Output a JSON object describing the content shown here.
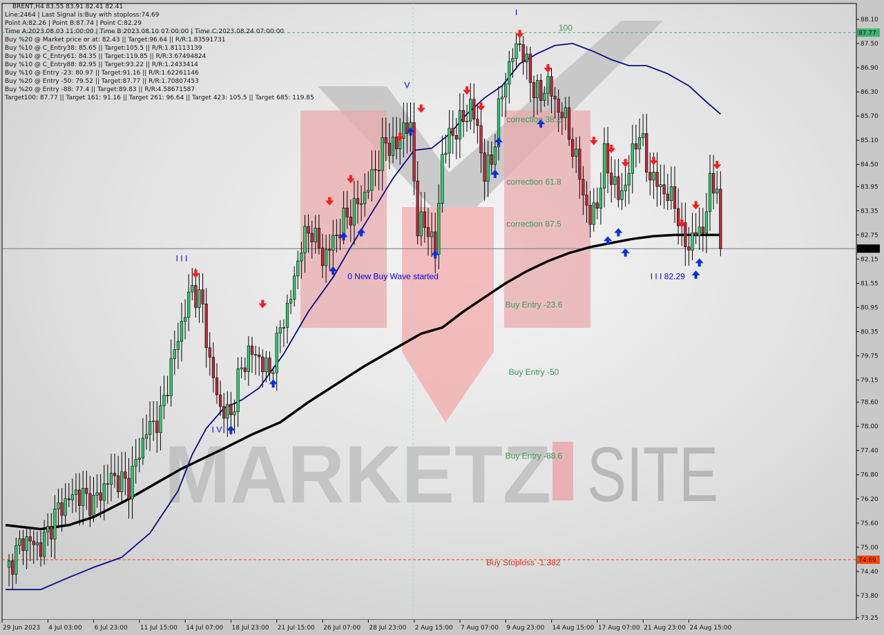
{
  "header": {
    "symbol_line": "BRENT,H4  83.55 83.91 82.41 82.41",
    "info_lines": [
      "Line:2464 | Last Signal is:Buy with stoploss:74.69",
      "Point A:82.26 | Point B:87.74 | Point C:82.29",
      "Time A:2023.08.03 11:00:00 | Time B:2023.08.10 07:00:00 | Time C:2023.08.24 07:00:00",
      "Buy %20 @ Market price or at: 82.43 || Target:96.64 || R/R:1.83591731",
      "Buy %10 @ C_Entry38: 85.65 || Target:105.5 || R/R:1.81113139",
      "Buy %10 @ C_Entry61: 84.35 || Target:119.85 || R/R:3.67494824",
      "Buy %10 @ C_Entry88: 82.95 || Target:93.22 || R/R:1.2433414",
      "Buy %10 @ Entry -23: 80.97 || Target:91.16 || R/R:1.62261146",
      "Buy %20 @ Entry -50: 79.52 || Target:87.77 || R/R:1.70807453",
      "Buy %20 @ Entry -88: 77.4 || Target:89.83 || R/R:4.58671587",
      "Target100: 87.77 || Target 161: 91.16 || Target 261: 96.64 || Target 423: 105.5 || Target 685: 119.85"
    ]
  },
  "watermark": {
    "left": "MARKETZ",
    "right": "SITE"
  },
  "colors": {
    "bull": "#2ecc71",
    "bear": "#c0283c",
    "ma_fast": "#0a0a8a",
    "ma_slow": "#000000",
    "target_line": "#3cb371",
    "stop_line": "#ff4500",
    "price_line": "#6a7a8a",
    "annotation_green": "#3c9a5a",
    "annotation_blue": "#0000dd",
    "annotation_red": "#e8321e",
    "signal_up": "#0a2ee0",
    "signal_down": "#ff1a1a"
  },
  "chart_data": {
    "type": "candlestick",
    "symbol": "BRENT",
    "timeframe": "H4",
    "ohlc_last": {
      "open": 83.55,
      "high": 83.91,
      "low": 82.41,
      "close": 82.41
    },
    "ylim": [
      73.25,
      88.4
    ],
    "y_ticks": [
      "88.10",
      "87.50",
      "86.90",
      "86.30",
      "85.70",
      "85.10",
      "84.50",
      "83.95",
      "83.35",
      "82.75",
      "82.15",
      "81.55",
      "80.95",
      "80.35",
      "79.75",
      "79.15",
      "78.60",
      "78.00",
      "77.40",
      "76.80",
      "76.20",
      "75.60",
      "75.00",
      "74.40",
      "73.80",
      "73.25"
    ],
    "y_tick_values": [
      88.1,
      87.5,
      86.9,
      86.3,
      85.7,
      85.1,
      84.5,
      83.95,
      83.35,
      82.75,
      82.15,
      81.55,
      80.95,
      80.35,
      79.75,
      79.15,
      78.6,
      78.0,
      77.4,
      76.8,
      76.2,
      75.6,
      75.0,
      74.4,
      73.8,
      73.25
    ],
    "x_ticks": [
      "29 Jun 2023",
      "4 Jul 03:00",
      "6 Jul 23:00",
      "11 Jul 15:00",
      "14 Jul 07:00",
      "18 Jul 23:00",
      "21 Jul 15:00",
      "26 Jul 07:00",
      "28 Jul 23:00",
      "2 Aug 15:00",
      "7 Aug 07:00",
      "9 Aug 23:00",
      "14 Aug 15:00",
      "17 Aug 07:00",
      "21 Aug 23:00",
      "24 Aug 15:00"
    ],
    "x_tick_bar_index": [
      0,
      13,
      26,
      39,
      52,
      65,
      78,
      91,
      104,
      117,
      130,
      143,
      156,
      169,
      182,
      195
    ],
    "bar_count": 244,
    "levels": [
      {
        "name": "target-100",
        "value": 87.77,
        "label": "87.77",
        "style": "dashed",
        "color": "#3cb371"
      },
      {
        "name": "current-price",
        "value": 82.41,
        "label": "82.41",
        "style": "solid",
        "color": "#6a7a8a"
      },
      {
        "name": "buy-stoploss",
        "value": 74.69,
        "label": "74.69",
        "style": "dashed",
        "color": "#ff4500"
      }
    ],
    "annotations": [
      {
        "text": "100",
        "bar": 159,
        "price": 87.82,
        "color": "#3c9a5a"
      },
      {
        "text": "correction 38.2",
        "bar": 150,
        "price": 85.55,
        "color": "#3c9a5a"
      },
      {
        "text": "correction 61.8",
        "bar": 150,
        "price": 84.0,
        "color": "#3c9a5a"
      },
      {
        "text": "correction 87.5",
        "bar": 150,
        "price": 82.95,
        "color": "#3c9a5a"
      },
      {
        "text": "Buy Entry -23.6",
        "bar": 150,
        "price": 80.95,
        "color": "#3c9a5a"
      },
      {
        "text": "Buy Entry -50",
        "bar": 150,
        "price": 79.28,
        "color": "#3c9a5a"
      },
      {
        "text": "Buy Entry -88.6",
        "bar": 150,
        "price": 77.2,
        "color": "#3c9a5a"
      },
      {
        "text": "Buy Stoploss -1.382",
        "bar": 147,
        "price": 74.55,
        "color": "#e8321e"
      },
      {
        "text": "0 New Buy Wave started",
        "bar": 110,
        "price": 81.65,
        "color": "#0000dd"
      },
      {
        "text": "I I I 82.29",
        "bar": 188,
        "price": 81.65,
        "color": "#0000dd"
      }
    ],
    "wave_labels": [
      {
        "text": "I",
        "bar": 145,
        "price": 88.2
      },
      {
        "text": "I I I",
        "bar": 50,
        "price": 82.1
      },
      {
        "text": "I V",
        "bar": 60,
        "price": 77.85
      },
      {
        "text": "V",
        "bar": 114,
        "price": 86.4
      }
    ],
    "signals_down": [
      {
        "bar": 54,
        "price": 81.75
      },
      {
        "bar": 73,
        "price": 81.0
      },
      {
        "bar": 92,
        "price": 83.55
      },
      {
        "bar": 98,
        "price": 84.1
      },
      {
        "bar": 112,
        "price": 85.15
      },
      {
        "bar": 118,
        "price": 85.85
      },
      {
        "bar": 131,
        "price": 86.3
      },
      {
        "bar": 135,
        "price": 85.9
      },
      {
        "bar": 146,
        "price": 87.7
      },
      {
        "bar": 154,
        "price": 86.85
      },
      {
        "bar": 167,
        "price": 85.05
      },
      {
        "bar": 172,
        "price": 84.85
      },
      {
        "bar": 176,
        "price": 84.5
      },
      {
        "bar": 184,
        "price": 84.55
      },
      {
        "bar": 192,
        "price": 83.0
      },
      {
        "bar": 196,
        "price": 83.45
      },
      {
        "bar": 202,
        "price": 84.45
      }
    ],
    "signals_up": [
      {
        "bar": 64,
        "price": 77.95
      },
      {
        "bar": 76,
        "price": 79.1
      },
      {
        "bar": 93,
        "price": 81.9
      },
      {
        "bar": 96,
        "price": 82.75
      },
      {
        "bar": 101,
        "price": 82.85
      },
      {
        "bar": 115,
        "price": 85.35
      },
      {
        "bar": 122,
        "price": 82.3
      },
      {
        "bar": 139,
        "price": 84.3
      },
      {
        "bar": 140,
        "price": 85.1
      },
      {
        "bar": 152,
        "price": 85.55
      },
      {
        "bar": 171,
        "price": 82.65
      },
      {
        "bar": 174,
        "price": 82.85
      },
      {
        "bar": 176,
        "price": 82.35
      },
      {
        "bar": 196,
        "price": 81.8
      },
      {
        "bar": 197,
        "price": 82.1
      }
    ],
    "ma_fast": [
      [
        0,
        73.95
      ],
      [
        10,
        73.95
      ],
      [
        18,
        74.25
      ],
      [
        25,
        74.5
      ],
      [
        33,
        74.75
      ],
      [
        41,
        75.35
      ],
      [
        49,
        76.4
      ],
      [
        53,
        77.3
      ],
      [
        57,
        77.95
      ],
      [
        62,
        78.45
      ],
      [
        67,
        78.65
      ],
      [
        72,
        78.95
      ],
      [
        79,
        79.8
      ],
      [
        86,
        80.85
      ],
      [
        93,
        81.7
      ],
      [
        98,
        82.45
      ],
      [
        104,
        83.3
      ],
      [
        110,
        84.15
      ],
      [
        116,
        84.85
      ],
      [
        121,
        84.9
      ],
      [
        126,
        85.25
      ],
      [
        131,
        85.75
      ],
      [
        136,
        86.15
      ],
      [
        141,
        86.45
      ],
      [
        146,
        87.0
      ],
      [
        151,
        87.25
      ],
      [
        156,
        87.45
      ],
      [
        161,
        87.5
      ],
      [
        167,
        87.3
      ],
      [
        172,
        87.1
      ],
      [
        177,
        86.95
      ],
      [
        182,
        86.95
      ],
      [
        188,
        86.75
      ],
      [
        194,
        86.45
      ],
      [
        199,
        86.05
      ],
      [
        203,
        85.75
      ]
    ],
    "ma_slow": [
      [
        0,
        75.55
      ],
      [
        10,
        75.45
      ],
      [
        18,
        75.55
      ],
      [
        25,
        75.75
      ],
      [
        34,
        76.15
      ],
      [
        42,
        76.55
      ],
      [
        50,
        76.95
      ],
      [
        56,
        77.2
      ],
      [
        62,
        77.45
      ],
      [
        70,
        77.8
      ],
      [
        78,
        78.1
      ],
      [
        86,
        78.6
      ],
      [
        94,
        79.05
      ],
      [
        102,
        79.5
      ],
      [
        110,
        79.9
      ],
      [
        118,
        80.3
      ],
      [
        124,
        80.45
      ],
      [
        130,
        80.85
      ],
      [
        136,
        81.2
      ],
      [
        142,
        81.55
      ],
      [
        148,
        81.85
      ],
      [
        154,
        82.1
      ],
      [
        160,
        82.3
      ],
      [
        166,
        82.45
      ],
      [
        172,
        82.55
      ],
      [
        178,
        82.65
      ],
      [
        184,
        82.72
      ],
      [
        190,
        82.75
      ],
      [
        196,
        82.75
      ],
      [
        203,
        82.75
      ]
    ],
    "candles_key": [
      [
        0,
        74.35
      ],
      [
        5,
        75.2
      ],
      [
        10,
        75.0
      ],
      [
        15,
        75.95
      ],
      [
        20,
        76.35
      ],
      [
        25,
        76.1
      ],
      [
        30,
        76.75
      ],
      [
        35,
        76.55
      ],
      [
        40,
        77.9
      ],
      [
        44,
        78.25
      ],
      [
        47,
        79.5
      ],
      [
        50,
        80.55
      ],
      [
        53,
        81.45
      ],
      [
        56,
        80.95
      ],
      [
        58,
        79.55
      ],
      [
        61,
        78.45
      ],
      [
        64,
        78.25
      ],
      [
        66,
        79.15
      ],
      [
        69,
        79.85
      ],
      [
        72,
        79.7
      ],
      [
        75,
        79.3
      ],
      [
        78,
        80.4
      ],
      [
        81,
        81.2
      ],
      [
        84,
        82.55
      ],
      [
        87,
        82.9
      ],
      [
        90,
        82.15
      ],
      [
        93,
        82.6
      ],
      [
        96,
        83.1
      ],
      [
        99,
        83.4
      ],
      [
        102,
        83.75
      ],
      [
        105,
        84.4
      ],
      [
        108,
        85.05
      ],
      [
        111,
        84.9
      ],
      [
        113,
        85.5
      ],
      [
        115,
        85.3
      ],
      [
        117,
        83.0
      ],
      [
        120,
        82.95
      ],
      [
        122,
        82.3
      ],
      [
        124,
        84.75
      ],
      [
        127,
        85.3
      ],
      [
        130,
        85.6
      ],
      [
        132,
        85.95
      ],
      [
        134,
        85.4
      ],
      [
        136,
        84.25
      ],
      [
        138,
        84.6
      ],
      [
        140,
        85.8
      ],
      [
        142,
        86.65
      ],
      [
        144,
        87.2
      ],
      [
        146,
        87.55
      ],
      [
        148,
        86.9
      ],
      [
        150,
        86.4
      ],
      [
        152,
        86.15
      ],
      [
        154,
        86.6
      ],
      [
        156,
        85.95
      ],
      [
        158,
        85.85
      ],
      [
        160,
        85.25
      ],
      [
        162,
        84.6
      ],
      [
        164,
        83.8
      ],
      [
        166,
        83.1
      ],
      [
        168,
        83.55
      ],
      [
        170,
        84.65
      ],
      [
        172,
        84.2
      ],
      [
        174,
        83.7
      ],
      [
        176,
        84.0
      ],
      [
        178,
        84.75
      ],
      [
        180,
        85.35
      ],
      [
        182,
        84.45
      ],
      [
        184,
        84.1
      ],
      [
        186,
        83.95
      ],
      [
        188,
        83.7
      ],
      [
        190,
        83.6
      ],
      [
        192,
        82.7
      ],
      [
        194,
        82.5
      ],
      [
        196,
        82.8
      ],
      [
        198,
        82.9
      ],
      [
        200,
        83.95
      ],
      [
        202,
        84.05
      ],
      [
        203,
        82.41
      ]
    ]
  }
}
